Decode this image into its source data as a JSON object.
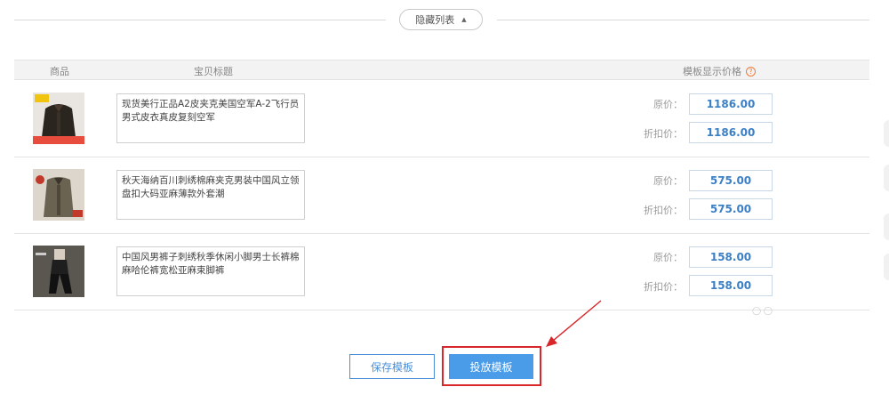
{
  "toggle": {
    "label": "隐藏列表"
  },
  "table": {
    "headers": {
      "product": "商品",
      "title": "宝贝标题",
      "price": "模板显示价格"
    }
  },
  "labels": {
    "original_price": "原价：",
    "discount_price": "折扣价："
  },
  "rows": [
    {
      "title": "现货美行正品A2皮夹克美国空军A-2飞行员男式皮衣真皮复刻空军",
      "original_price": "1186.00",
      "discount_price": "1186.00"
    },
    {
      "title": "秋天海纳百川刺绣棉麻夹克男装中国风立领盘扣大码亚麻薄款外套潮",
      "original_price": "575.00",
      "discount_price": "575.00"
    },
    {
      "title": "中国风男裤子刺绣秋季休闲小脚男士长裤棉麻哈伦裤宽松亚麻束脚裤",
      "original_price": "158.00",
      "discount_price": "158.00"
    }
  ],
  "buttons": {
    "save": "保存模板",
    "deploy": "投放模板"
  },
  "colors": {
    "accent": "#4a9be8",
    "price_text": "#3b7fc4",
    "highlight": "#d8262a"
  }
}
